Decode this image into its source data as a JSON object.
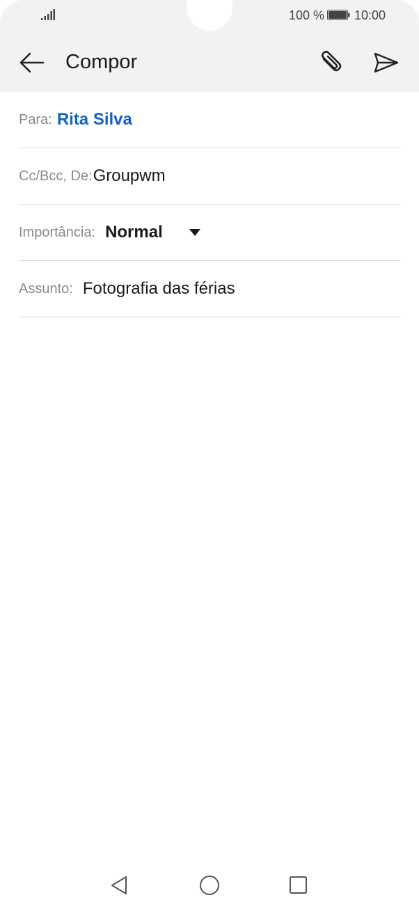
{
  "status_bar": {
    "battery_percent": "100 %",
    "time": "10:00",
    "icons": [
      "signal-icon",
      "battery-icon"
    ]
  },
  "app_bar": {
    "title": "Compor",
    "icons": [
      "back-arrow-icon",
      "paperclip-icon",
      "send-icon"
    ]
  },
  "fields": {
    "to": {
      "label": "Para:",
      "value": "Rita Silva"
    },
    "cc": {
      "label": "Cc/Bcc, De:",
      "value": "Groupwm"
    },
    "importance": {
      "label": "Importância:",
      "value": "Normal"
    },
    "subject": {
      "label": "Assunto:",
      "value": "Fotografia das férias"
    }
  },
  "colors": {
    "accent": "#1565c0",
    "header_bg": "#f2f2f2",
    "divider": "#dcdcdc"
  },
  "nav_bar": {
    "icons": [
      "nav-back-icon",
      "nav-home-icon",
      "nav-recents-icon"
    ]
  }
}
